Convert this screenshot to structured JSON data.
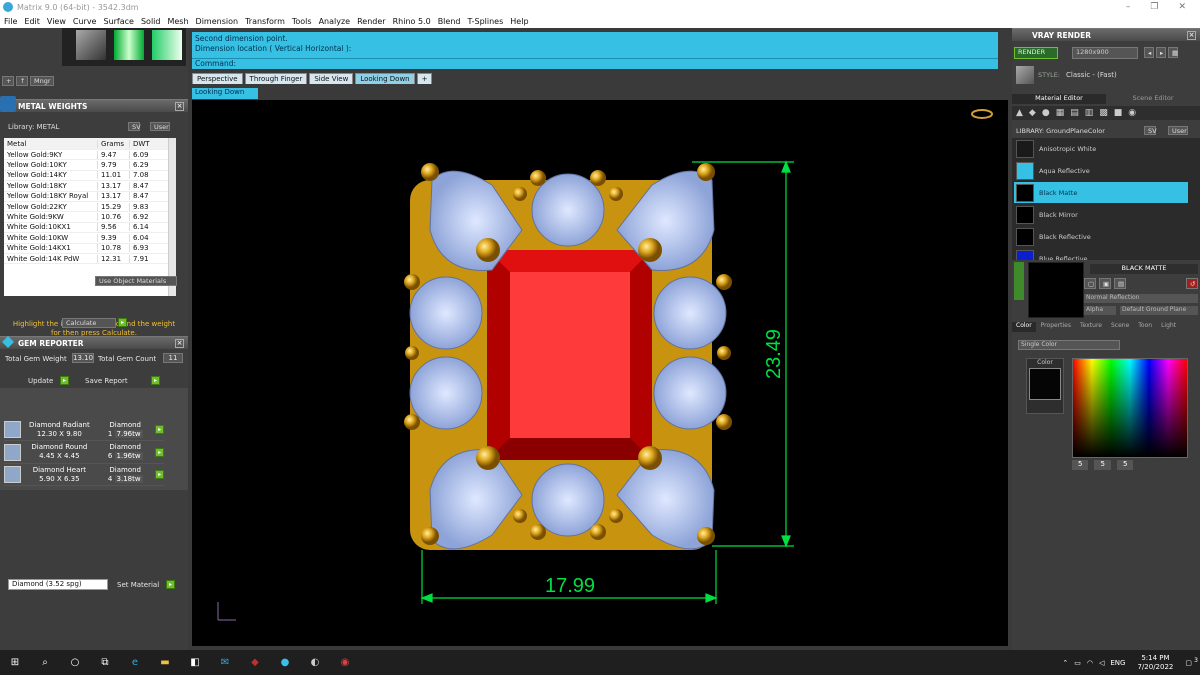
{
  "window": {
    "title": "Matrix 9.0 (64-bit) - 3542.3dm",
    "min": "–",
    "max": "❐",
    "close": "✕"
  },
  "menu": [
    "File",
    "Edit",
    "View",
    "Curve",
    "Surface",
    "Solid",
    "Mesh",
    "Dimension",
    "Transform",
    "Tools",
    "Analyze",
    "Render",
    "Rhino 5.0",
    "Blend",
    "T-Splines",
    "Help"
  ],
  "left_toolbar": {
    "mngr_label": "Mngr"
  },
  "metal_weights": {
    "title": "METAL WEIGHTS",
    "library_label": "Library: METAL",
    "sv_label": "SV",
    "user_label": "User",
    "headers": [
      "Metal",
      "Grams",
      "DWT"
    ],
    "rows": [
      [
        "Yellow Gold:9KY",
        "9.47",
        "6.09"
      ],
      [
        "Yellow Gold:10KY",
        "9.79",
        "6.29"
      ],
      [
        "Yellow Gold:14KY",
        "11.01",
        "7.08"
      ],
      [
        "Yellow Gold:18KY",
        "13.17",
        "8.47"
      ],
      [
        "Yellow Gold:18KY Royal",
        "13.17",
        "8.47"
      ],
      [
        "Yellow Gold:22KY",
        "15.29",
        "9.83"
      ],
      [
        "White Gold:9KW",
        "10.76",
        "6.92"
      ],
      [
        "White Gold:10KX1",
        "9.56",
        "6.14"
      ],
      [
        "White Gold:10KW",
        "9.39",
        "6.04"
      ],
      [
        "White Gold:14KX1",
        "10.78",
        "6.93"
      ],
      [
        "White Gold:14K PdW",
        "12.31",
        "7.91"
      ]
    ],
    "use_object_materials": "Use Object Materials",
    "hint": "Highlight the item you want to find the weight for then press Calculate.",
    "calculate_label": "Calculate"
  },
  "gem_reporter": {
    "title": "GEM REPORTER",
    "total_weight_label": "Total Gem Weight",
    "total_weight_value": "13.10",
    "total_count_label": "Total Gem Count",
    "total_count_value": "11",
    "update_label": "Update",
    "save_report_label": "Save Report",
    "gems": [
      {
        "name": "Diamond Radiant",
        "size": "12.30 X 9.80",
        "type": "Diamond",
        "count": "1",
        "ctw": "7.96tw"
      },
      {
        "name": "Diamond Round",
        "size": "4.45 X 4.45",
        "type": "Diamond",
        "count": "6",
        "ctw": "1.96tw"
      },
      {
        "name": "Diamond Heart",
        "size": "5.90 X 6.35",
        "type": "Diamond",
        "count": "4",
        "ctw": "3.18tw"
      }
    ],
    "material_select": "Diamond    (3.52 spg)",
    "set_material_label": "Set Material"
  },
  "command": {
    "prompt_line1": "Second dimension point.",
    "prompt_line2": "Dimension location ( Vertical  Horizontal ):",
    "command_label": "Command:"
  },
  "viewport_tabs": [
    "Perspective",
    "Through Finger",
    "Side View",
    "Looking Down"
  ],
  "active_view": "Looking Down",
  "add_tab": "+",
  "dimensions": {
    "height": "23.49",
    "width": "17.99"
  },
  "vray": {
    "title": "VRAY RENDER",
    "render_label": "RENDER",
    "resolution": "1280x900",
    "style_label": "STYLE:",
    "style_value": "Classic - (Fast)",
    "tabs": [
      "Material Editor",
      "Scene Editor"
    ],
    "library_label": "LIBRARY: GroundPlaneColor",
    "sv_label": "SV",
    "user_label": "User",
    "materials": [
      {
        "name": "Anisotropic White",
        "color": "#1a1a1a"
      },
      {
        "name": "Aqua Reflective",
        "color": "#36c0e3"
      },
      {
        "name": "Black Matte",
        "color": "#000000"
      },
      {
        "name": "Black Mirror",
        "color": "#000000"
      },
      {
        "name": "Black Reflective",
        "color": "#000000"
      },
      {
        "name": "Blue Reflective",
        "color": "#0a1fd0"
      }
    ],
    "selected_material": "BLACK MATTE",
    "reflection_select": "Normal Reflection",
    "alpha_label": "Alpha",
    "ground_plane_select": "Default Ground Plane",
    "bottom_tabs": [
      "Color",
      "Properties",
      "Texture",
      "Scene",
      "Toon",
      "Light"
    ],
    "color_mode": "Single Color",
    "color_label": "Color",
    "rgb": {
      "r": "5",
      "g": "5",
      "b": "5"
    }
  },
  "taskbar": {
    "language": "ENG",
    "time": "5:14 PM",
    "date": "7/20/2022",
    "notification_count": "3"
  }
}
